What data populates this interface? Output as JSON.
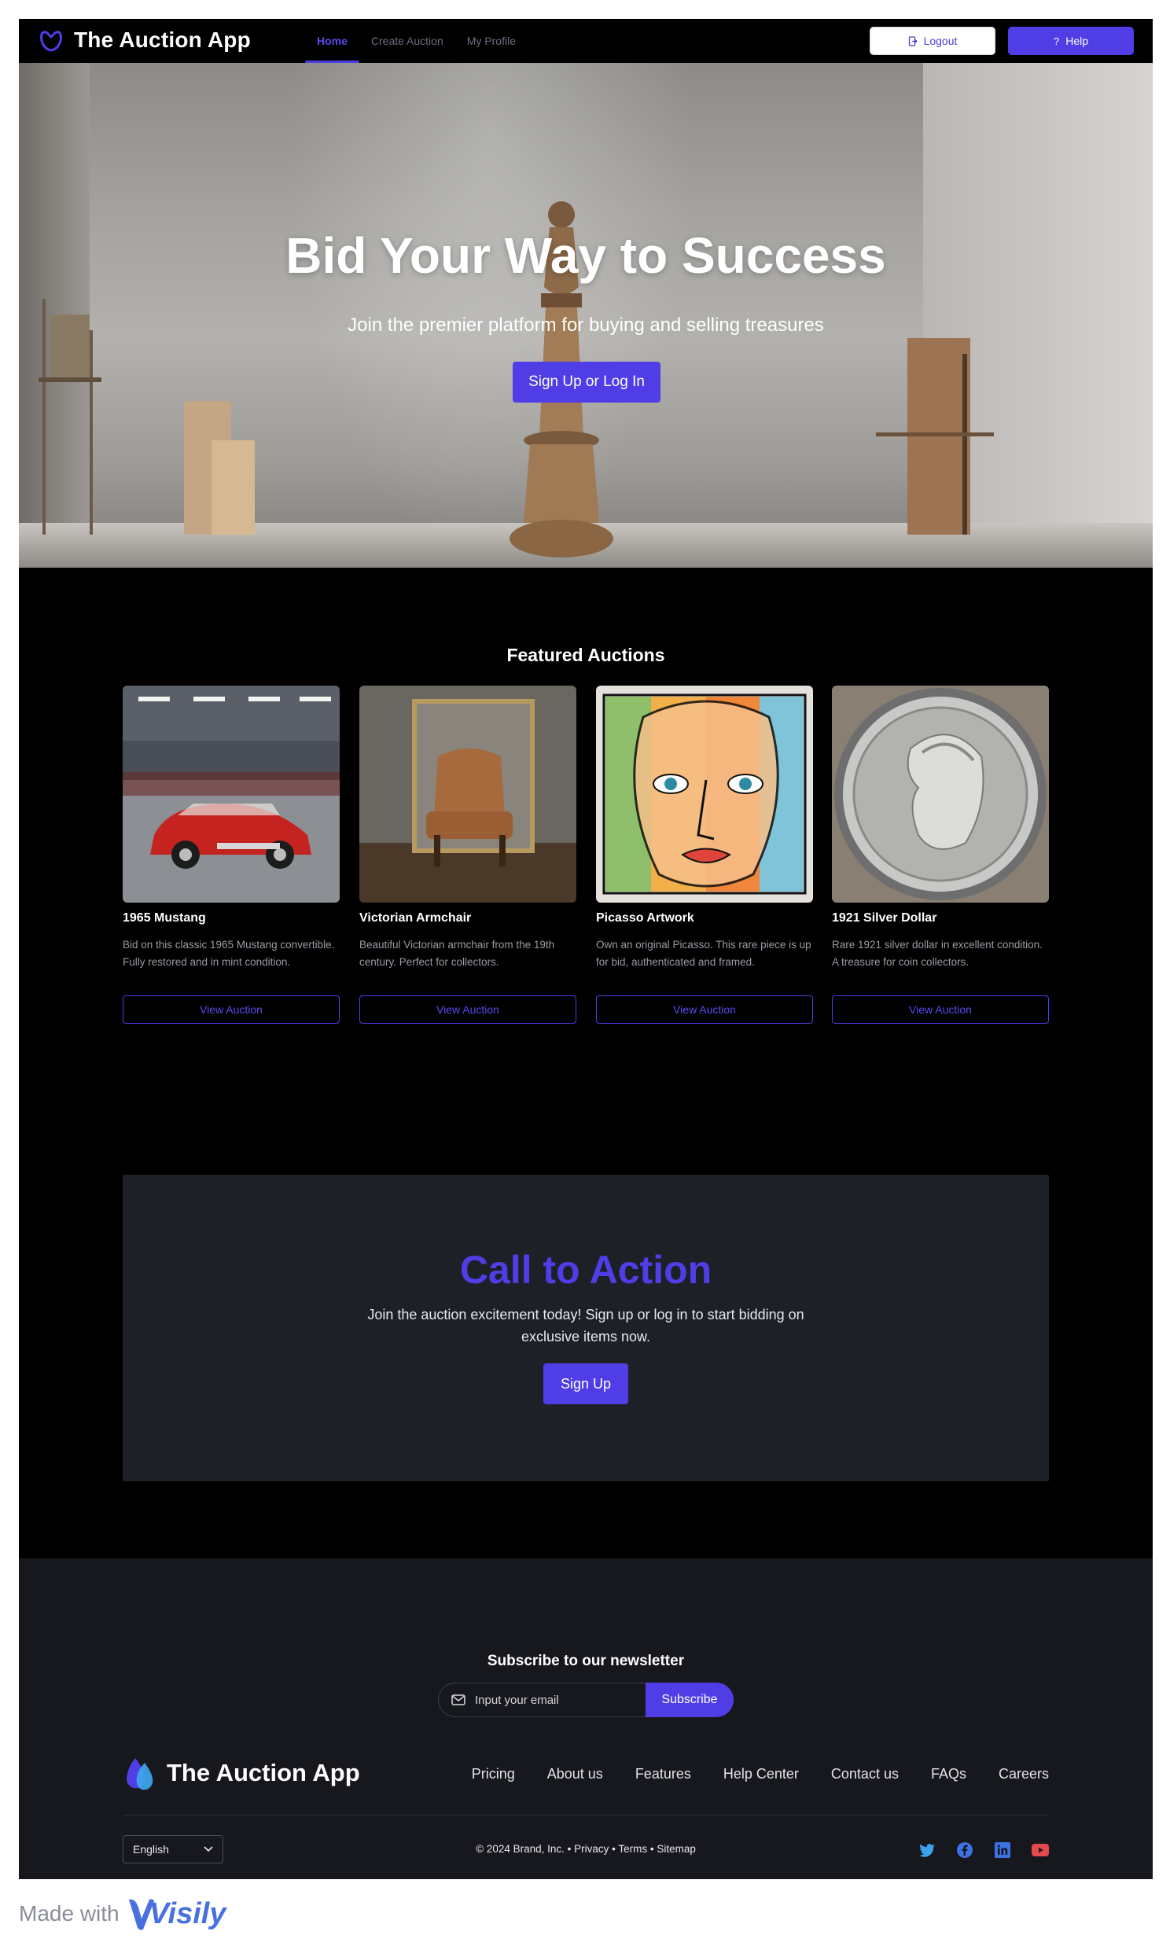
{
  "app": {
    "name": "The Auction App"
  },
  "nav": {
    "items": [
      {
        "label": "Home",
        "active": true
      },
      {
        "label": "Create Auction",
        "active": false
      },
      {
        "label": "My Profile",
        "active": false
      }
    ],
    "logout_label": "Logout",
    "help_label": "Help"
  },
  "hero": {
    "title": "Bid Your Way to Success",
    "subtitle": "Join the premier platform for buying and selling treasures",
    "cta_label": "Sign Up or Log In"
  },
  "featured": {
    "title": "Featured Auctions",
    "cards": [
      {
        "title": "1965 Mustang",
        "description": "Bid on this classic 1965 Mustang convertible. Fully restored and in mint condition.",
        "button": "View Auction",
        "image": "red-convertible-car"
      },
      {
        "title": "Victorian Armchair",
        "description": "Beautiful Victorian armchair from the 19th century. Perfect for collectors.",
        "button": "View Auction",
        "image": "victorian-armchair"
      },
      {
        "title": "Picasso Artwork",
        "description": "Own an original Picasso. This rare piece is up for bid, authenticated and framed.",
        "button": "View Auction",
        "image": "cubist-face-painting"
      },
      {
        "title": "1921 Silver Dollar",
        "description": "Rare 1921 silver dollar in excellent condition. A treasure for coin collectors.",
        "button": "View Auction",
        "image": "silver-dollar-coin"
      }
    ]
  },
  "cta": {
    "title": "Call to Action",
    "text": "Join the auction excitement today! Sign up or log in to start bidding on exclusive items now.",
    "button": "Sign Up"
  },
  "newsletter": {
    "title": "Subscribe to our newsletter",
    "placeholder": "Input your email",
    "button": "Subscribe"
  },
  "footer": {
    "brand": "The Auction App",
    "links": [
      "Pricing",
      "About us",
      "Features",
      "Help Center",
      "Contact us",
      "FAQs",
      "Careers"
    ],
    "language": "English",
    "legal": "© 2024 Brand, Inc. • Privacy • Terms • Sitemap",
    "social": [
      "twitter-icon",
      "facebook-icon",
      "linkedin-icon",
      "youtube-icon"
    ]
  },
  "made_with": {
    "label": "Made with",
    "brand": "Visily"
  },
  "colors": {
    "accent": "#4f3de6",
    "background": "#000000",
    "panel": "#1e2028",
    "footer": "#17181e"
  }
}
